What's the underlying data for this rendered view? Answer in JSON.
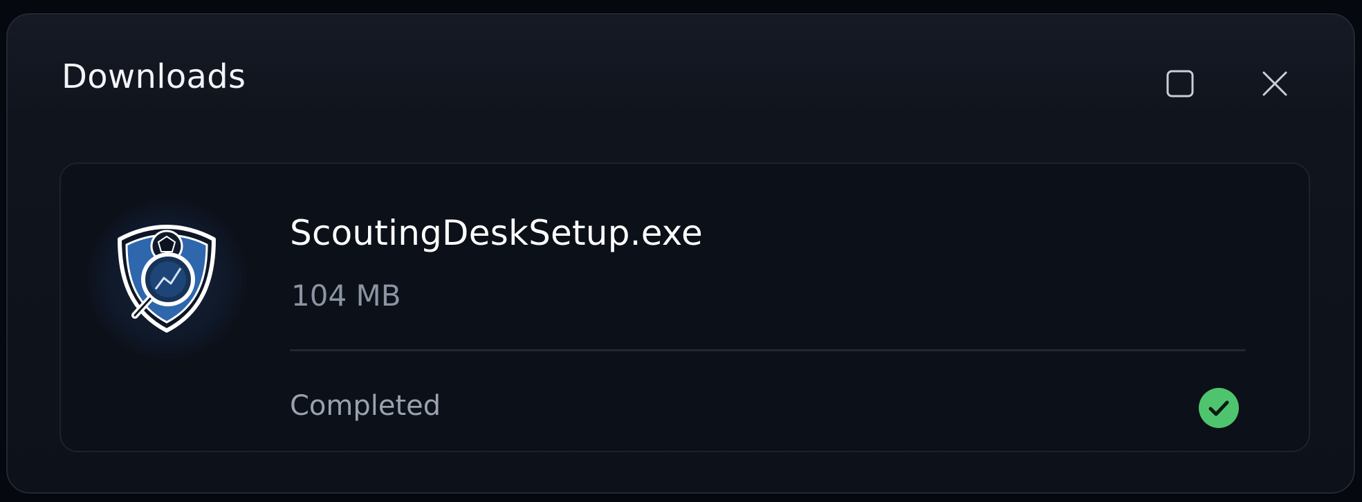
{
  "window": {
    "title": "Downloads",
    "maximize_icon": "square-icon",
    "close_icon": "close-x-icon"
  },
  "download": {
    "file_name": "ScoutingDeskSetup.exe",
    "file_size": "104 MB",
    "status": "Completed",
    "app_icon": "shield-magnifier-logo",
    "status_icon": "check-circle-icon"
  },
  "colors": {
    "background": "#0d1119",
    "success": "#4fc46e",
    "brand_blue": "#3d78c4"
  }
}
